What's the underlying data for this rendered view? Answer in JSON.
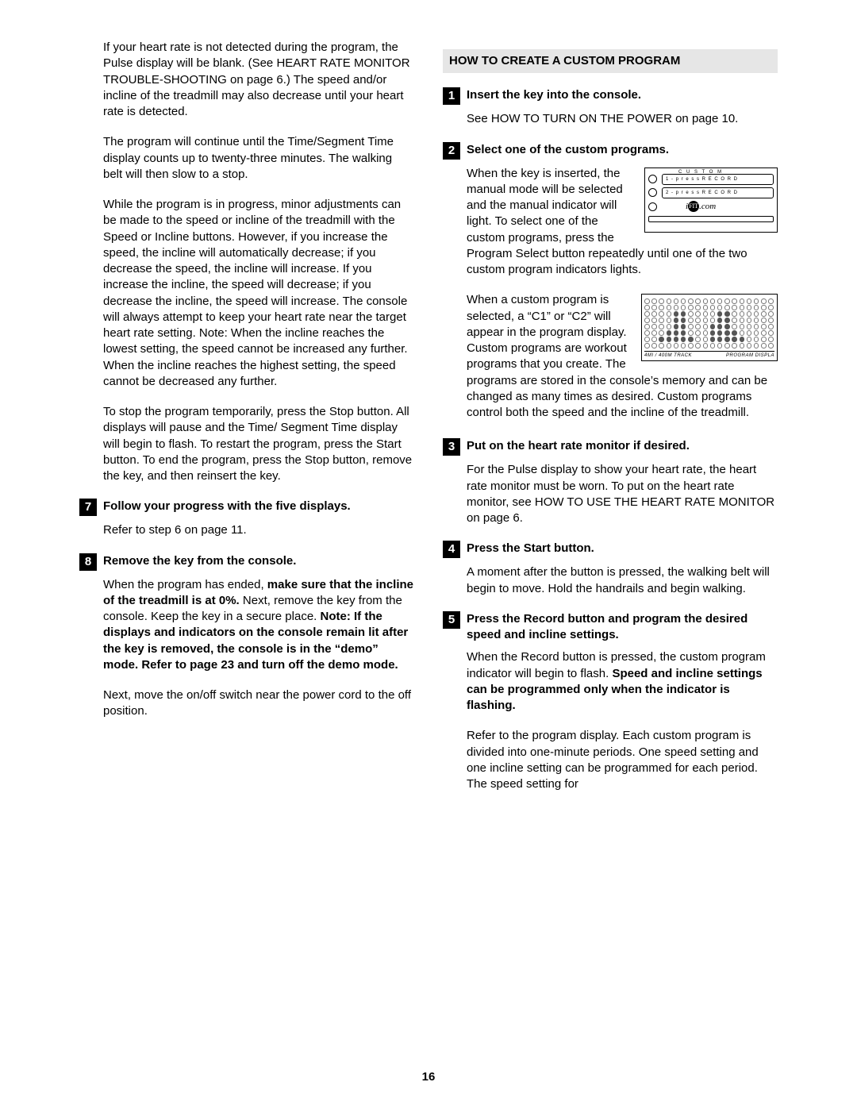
{
  "page_number": "16",
  "left": {
    "p1": "If your heart rate is not detected during the program, the Pulse display will be blank. (See HEART RATE MONITOR TROUBLE-SHOOTING on page 6.) The speed and/or incline of the treadmill may also decrease until your heart rate is detected.",
    "p2": "The program will continue until the Time/Segment Time display counts up to twenty-three minutes. The walking belt will then slow to a stop.",
    "p3": "While the program is in progress, minor adjustments can be made to the speed or incline of the treadmill with the Speed or Incline buttons. However, if you increase the speed, the incline will automatically decrease; if you decrease the speed, the incline will increase. If you increase the incline, the speed will decrease; if you decrease the incline, the speed will increase. The console will always attempt to keep your heart rate near the target heart rate setting. Note: When the incline reaches the lowest setting, the speed cannot be increased any further. When the incline reaches the highest setting, the speed cannot be decreased any further.",
    "p4": "To stop the program temporarily, press the Stop button. All displays will pause and the Time/ Segment Time display will begin to flash. To restart the program, press the Start button. To end the program, press the Stop button, remove the key, and then reinsert the key.",
    "step7_num": "7",
    "step7_title": "Follow your progress with the five displays.",
    "step7_body": "Refer to step 6 on page 11.",
    "step8_num": "8",
    "step8_title": "Remove the key from the console.",
    "step8_a": "When the program has ended, ",
    "step8_b_bold": "make sure that the incline of the treadmill is at 0%. ",
    "step8_c": "Next, remove the key from the console. Keep the key in a secure place. ",
    "step8_d_bold": "Note: If the displays and indicators on the console remain lit after the key is removed, the console is in the “demo” mode. Refer to page 23 and turn off the demo mode.",
    "step8_p2": "Next, move the on/off switch near the power cord to the off position."
  },
  "right": {
    "heading": "HOW TO CREATE A CUSTOM PROGRAM",
    "s1_num": "1",
    "s1_title": "Insert the key into the console.",
    "s1_body": "See HOW TO TURN ON THE POWER on page 10.",
    "s2_num": "2",
    "s2_title": "Select one of the custom programs.",
    "s2_p1": "When the key is inserted, the manual mode will be selected and the manual indicator will light. To select one of the custom programs, press the Program Select button repeatedly until one of the two custom program indicators lights.",
    "s2_p2": "When a custom program is selected, a “C1” or “C2” will appear in the program display. Custom programs are workout programs that you create. The programs are stored in the console’s memory and can be changed as many times as desired. Custom programs control both the speed and the incline of the treadmill.",
    "s3_num": "3",
    "s3_title": "Put on the heart rate monitor if desired.",
    "s3_body": "For the Pulse display to show your heart rate, the heart rate monitor must be worn. To put on the heart rate monitor, see HOW TO USE THE HEART RATE MONITOR on page 6.",
    "s4_num": "4",
    "s4_title": "Press the Start button.",
    "s4_body": "A moment after the button is pressed, the walking belt will begin to move. Hold the handrails and begin walking.",
    "s5_num": "5",
    "s5_title": "Press the Record button and program the desired speed and incline settings.",
    "s5_p1a": "When the Record button is pressed, the custom program indicator will begin to flash. ",
    "s5_p1b_bold": "Speed and incline settings can be programmed only when the indicator is flashing.",
    "s5_p2": "Refer to the program display. Each custom program is divided into one-minute periods. One speed setting and one incline setting can be programmed for each period. The speed setting for"
  },
  "fig1": {
    "top": "C U S T O M",
    "slot1": "1 -  p r e s s  R E C O R D",
    "slot2": "2 -  p r e s s  R E C O R D",
    "logo_i": "i",
    "logo_mid": "FIT",
    "logo_dot": ".com"
  },
  "fig2": {
    "left": "4MI  /  400M TRACK",
    "right": "PROGRAM DISPLA"
  },
  "chart_data": {
    "type": "heatmap",
    "description": "Treadmill program-display dot matrix, 8 rows × 18 columns. 1 = filled LED dot, 0 = empty.",
    "rows": 8,
    "cols": 18,
    "grid": [
      [
        0,
        0,
        0,
        0,
        0,
        0,
        0,
        0,
        0,
        0,
        0,
        0,
        0,
        0,
        0,
        0,
        0,
        0
      ],
      [
        0,
        0,
        0,
        0,
        0,
        0,
        0,
        0,
        0,
        0,
        0,
        0,
        0,
        0,
        0,
        0,
        0,
        0
      ],
      [
        0,
        0,
        0,
        0,
        1,
        1,
        0,
        0,
        0,
        0,
        1,
        1,
        0,
        0,
        0,
        0,
        0,
        0
      ],
      [
        0,
        0,
        0,
        0,
        1,
        1,
        0,
        0,
        0,
        0,
        1,
        1,
        0,
        0,
        0,
        0,
        0,
        0
      ],
      [
        0,
        0,
        0,
        0,
        1,
        1,
        0,
        0,
        0,
        1,
        1,
        1,
        0,
        0,
        0,
        0,
        0,
        0
      ],
      [
        0,
        0,
        0,
        1,
        1,
        1,
        0,
        0,
        0,
        1,
        1,
        1,
        1,
        0,
        0,
        0,
        0,
        0
      ],
      [
        0,
        0,
        1,
        1,
        1,
        1,
        1,
        0,
        0,
        1,
        1,
        1,
        1,
        1,
        0,
        0,
        0,
        0
      ],
      [
        0,
        0,
        0,
        0,
        0,
        0,
        0,
        0,
        0,
        0,
        0,
        0,
        0,
        0,
        0,
        0,
        0,
        0
      ]
    ],
    "footer_left": "4MI / 400M TRACK",
    "footer_right": "PROGRAM DISPLAY"
  }
}
